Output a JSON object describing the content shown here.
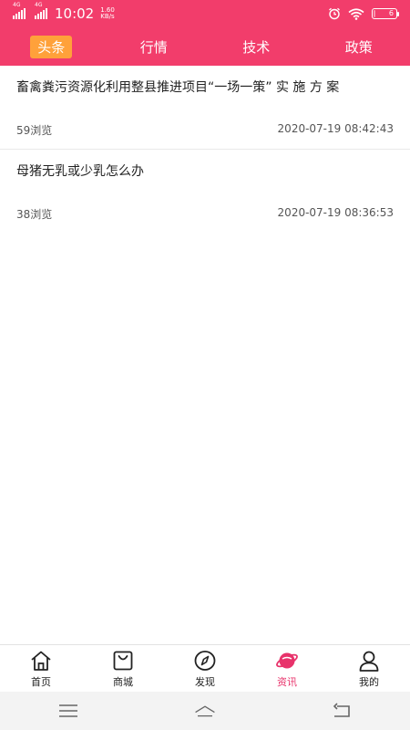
{
  "status_bar": {
    "network_1": "4G",
    "network_2": "4G",
    "time": "10:02",
    "speed_value": "1.60",
    "speed_unit": "KB/s",
    "battery": "6"
  },
  "tabs": [
    {
      "label": "头条",
      "active": true
    },
    {
      "label": "行情",
      "active": false
    },
    {
      "label": "技术",
      "active": false
    },
    {
      "label": "政策",
      "active": false
    }
  ],
  "articles": [
    {
      "title": "畜禽粪污资源化利用整县推进项目“一场一策” 实 施 方 案",
      "views": "59浏览",
      "date": "2020-07-19 08:42:43"
    },
    {
      "title": "母猪无乳或少乳怎么办",
      "views": "38浏览",
      "date": "2020-07-19 08:36:53"
    }
  ],
  "bottom_nav": [
    {
      "label": "首页",
      "icon": "home-icon"
    },
    {
      "label": "商城",
      "icon": "bag-icon"
    },
    {
      "label": "发现",
      "icon": "compass-icon"
    },
    {
      "label": "资讯",
      "icon": "planet-icon",
      "active": true
    },
    {
      "label": "我的",
      "icon": "user-icon"
    }
  ],
  "colors": {
    "header": "#f23d6b",
    "active_tab": "#ffa13a",
    "nav_active": "#e8336b"
  }
}
